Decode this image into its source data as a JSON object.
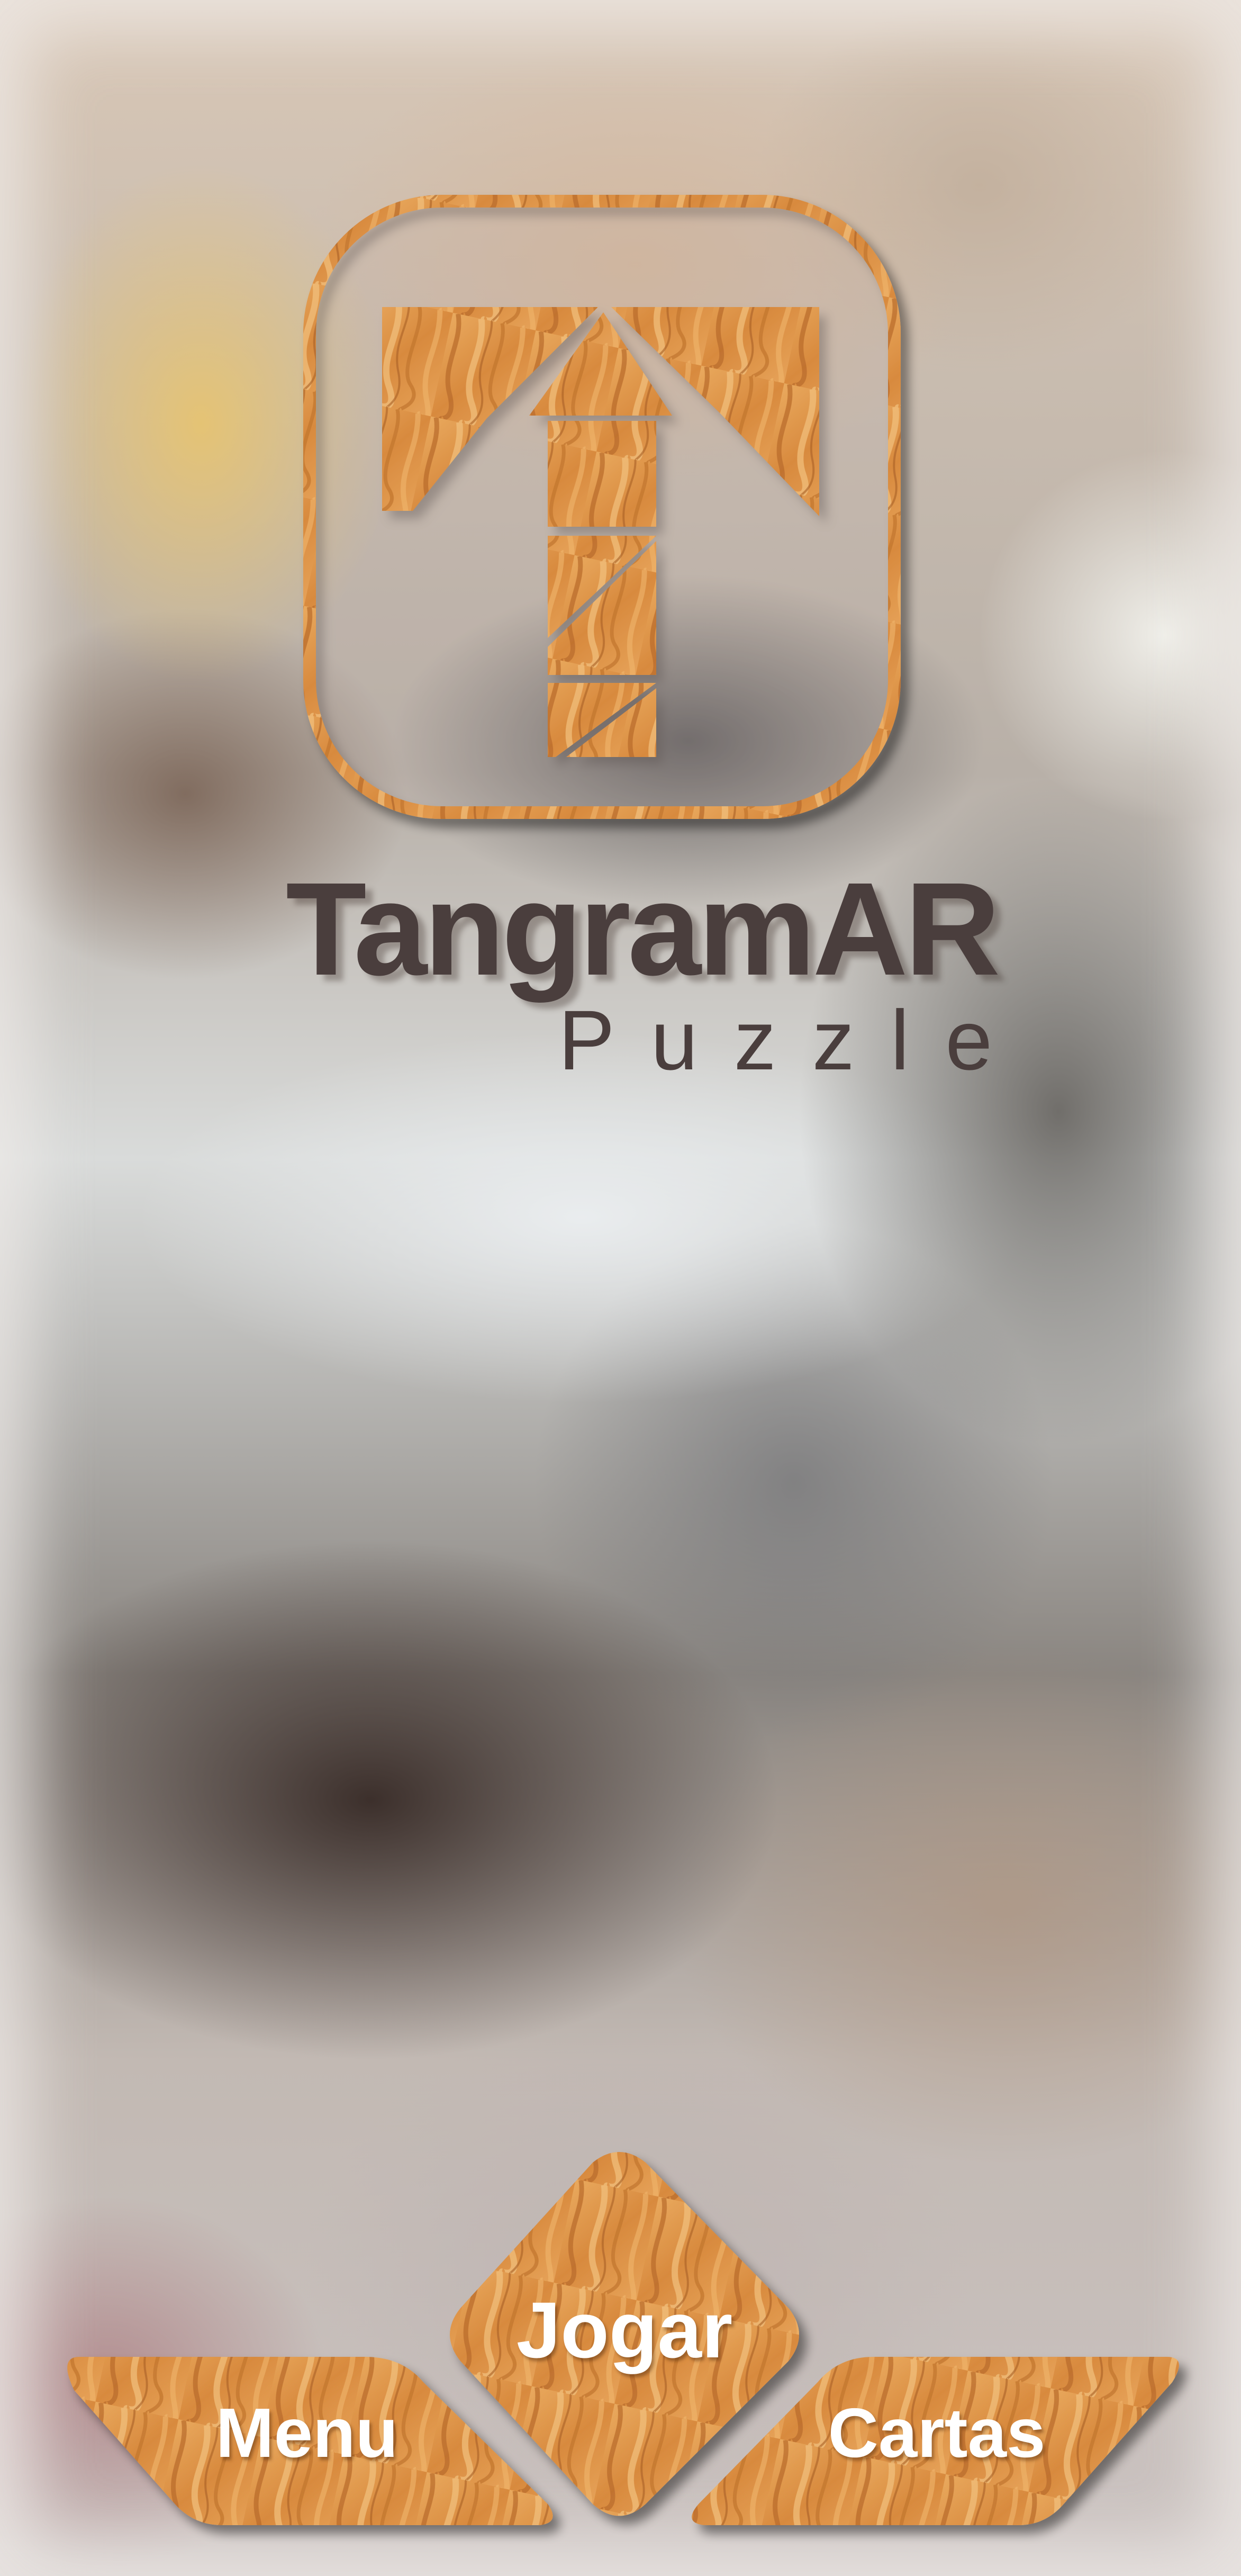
{
  "app": {
    "title": "TangramAR",
    "subtitle": "Puzzle"
  },
  "buttons": {
    "play_label": "Jogar",
    "menu_label": "Menu",
    "cards_label": "Cartas"
  },
  "icons": {
    "logo": "tangram-t-logo-icon"
  },
  "colors": {
    "wood_light": "#e9a45a",
    "wood_dark": "#b8692a",
    "title_text": "#4a3e3d",
    "button_text": "#ffffff"
  }
}
